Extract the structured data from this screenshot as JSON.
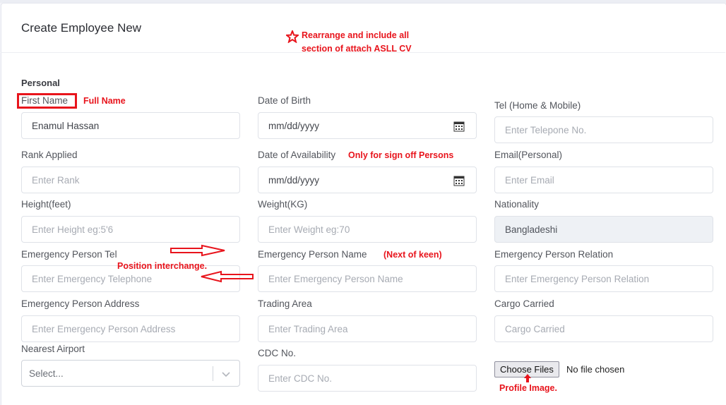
{
  "page": {
    "title": "Create Employee New",
    "section_personal": "Personal"
  },
  "fields": {
    "first_name": {
      "label": "First Name",
      "value": "Enamul Hassan"
    },
    "date_of_birth": {
      "label": "Date of Birth",
      "value": "mm/dd/yyyy"
    },
    "tel": {
      "label": "Tel (Home & Mobile)",
      "placeholder": "Enter Telepone No."
    },
    "rank_applied": {
      "label": "Rank Applied",
      "placeholder": "Enter Rank"
    },
    "date_of_availability": {
      "label": "Date of Availability",
      "value": "mm/dd/yyyy"
    },
    "email": {
      "label": "Email(Personal)",
      "placeholder": "Enter Email"
    },
    "height": {
      "label": "Height(feet)",
      "placeholder": "Enter Height eg:5'6"
    },
    "weight": {
      "label": "Weight(KG)",
      "placeholder": "Enter Weight eg:70"
    },
    "nationality": {
      "label": "Nationality",
      "value": "Bangladeshi"
    },
    "emergency_tel": {
      "label": "Emergency Person Tel",
      "placeholder": "Enter Emergency Telephone"
    },
    "emergency_name": {
      "label": "Emergency Person Name",
      "placeholder": "Enter Emergency Person Name"
    },
    "emergency_relation": {
      "label": "Emergency Person Relation",
      "placeholder": "Enter Emergency Person Relation"
    },
    "emergency_address": {
      "label": "Emergency Person Address",
      "placeholder": "Enter Emergency Person Address"
    },
    "trading_area": {
      "label": "Trading Area",
      "placeholder": "Enter Trading Area"
    },
    "cargo_carried": {
      "label": "Cargo Carried",
      "placeholder": "Cargo Carried"
    },
    "nearest_airport": {
      "label": "Nearest Airport",
      "selected": "Select..."
    },
    "cdc_no": {
      "label": "CDC No.",
      "placeholder": "Enter CDC No."
    },
    "profile_file": {
      "button": "Choose Files",
      "status": "No file chosen"
    }
  },
  "annotations": {
    "rearrange_line1": "Rearrange and include all",
    "rearrange_line2": "section of attach ASLL CV",
    "full_name": "Full Name",
    "sign_off": "Only for sign off Persons",
    "position_interchange": "Position interchange.",
    "next_of_keen": "(Next of keen)",
    "profile_image": "Profile Image.",
    "color": "#e8141c"
  }
}
